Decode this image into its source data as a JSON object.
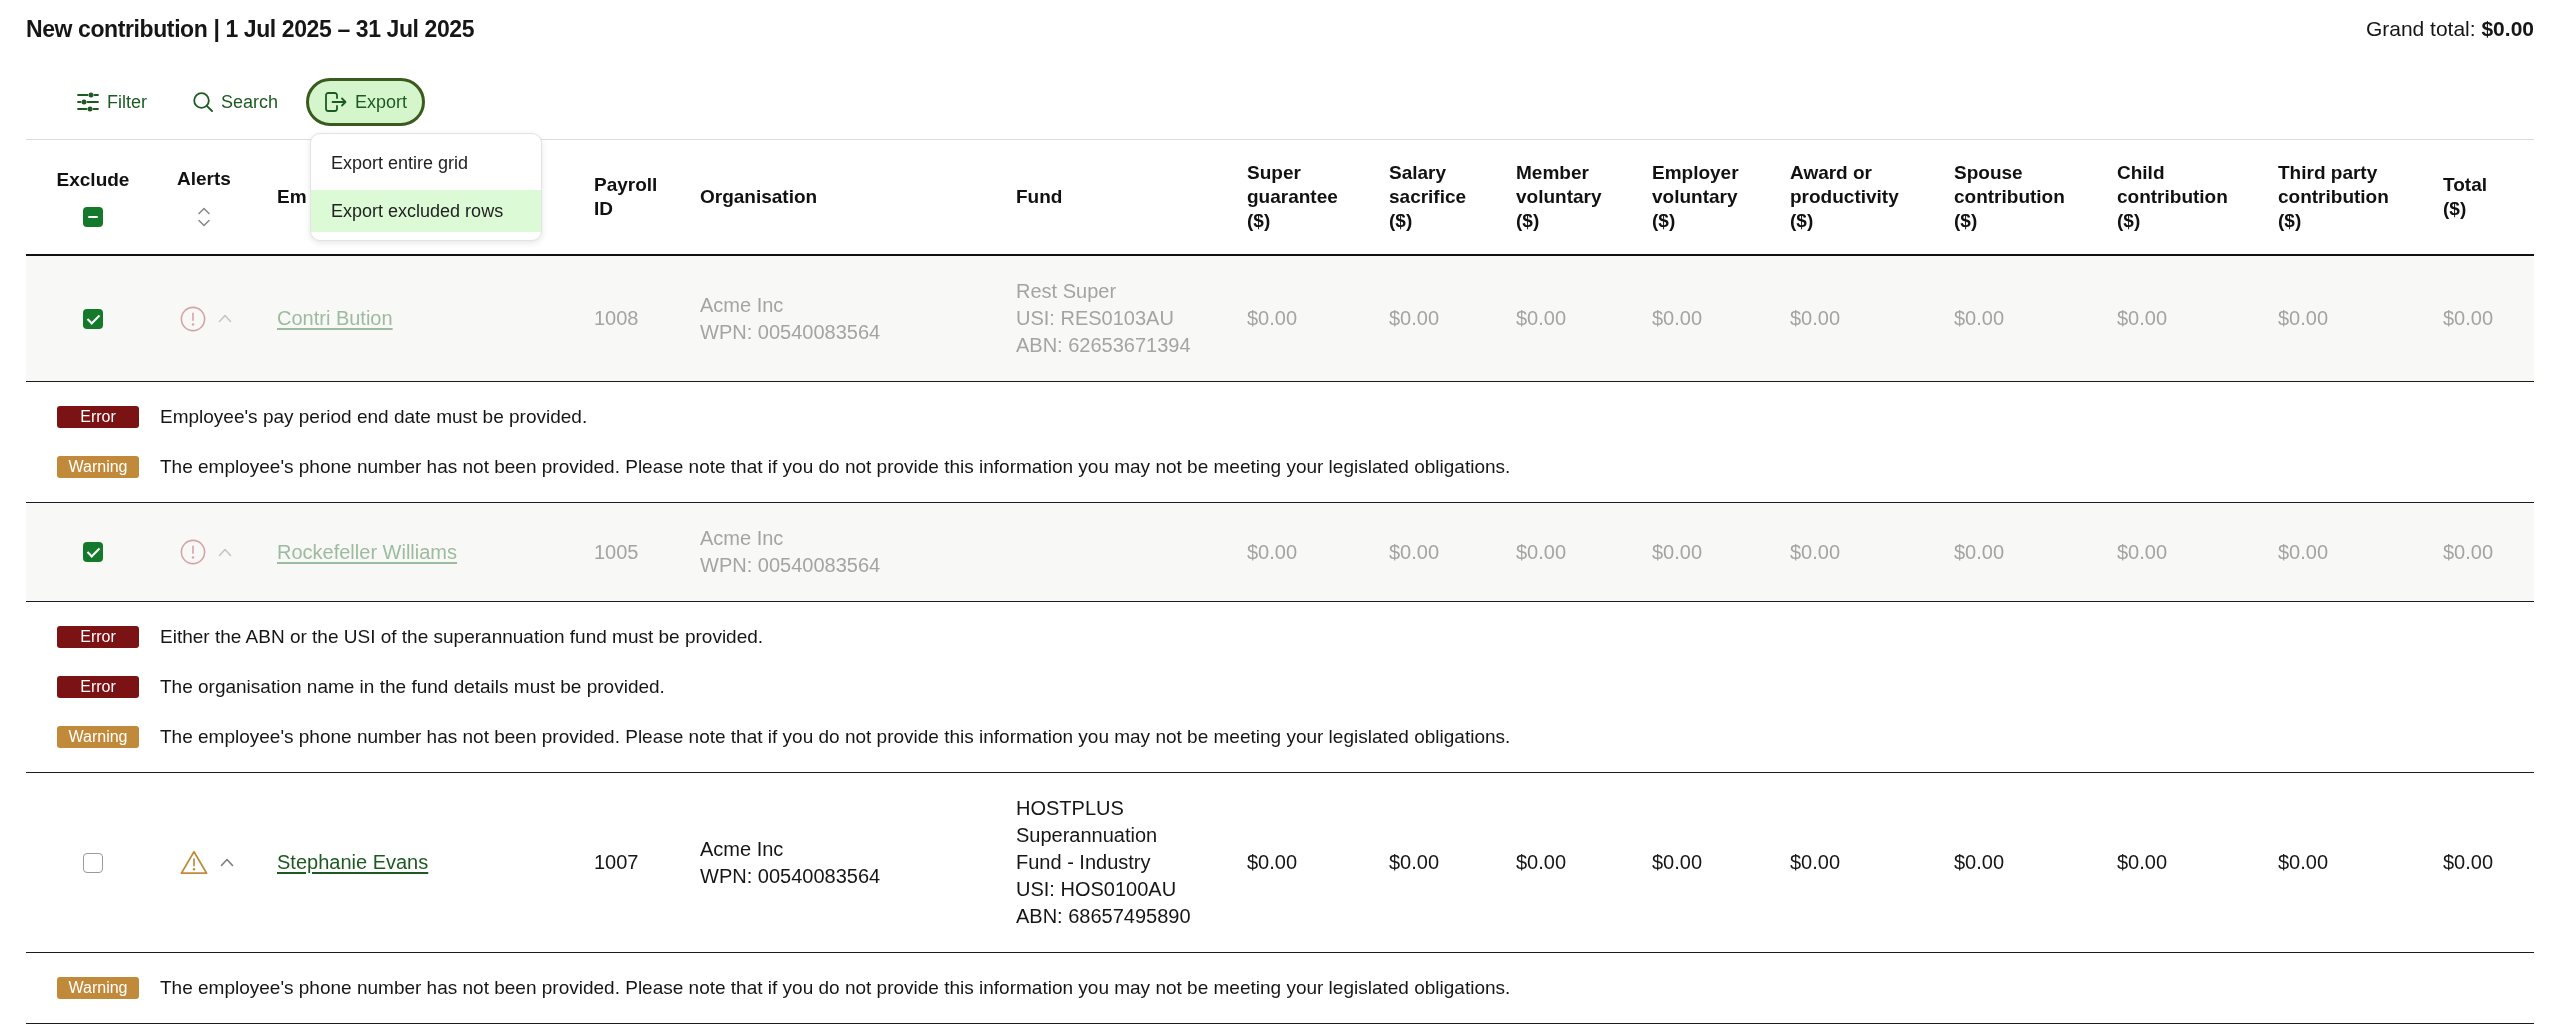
{
  "page": {
    "title": "New contribution | 1 Jul 2025 – 31 Jul 2025",
    "grand_total": "Grand total: **$0.00**"
  },
  "toolbar": [
    {
      "kind": "filter",
      "label": "Filter",
      "expanded": false
    },
    {
      "kind": "search",
      "label": "Search",
      "expanded": false
    },
    {
      "kind": "export",
      "label": "Export",
      "expanded": true,
      "menu": [
        {
          "label": "Export entire grid",
          "selected": false
        },
        {
          "label": "Export excluded rows",
          "selected": true
        }
      ]
    }
  ],
  "table": {
    "columns": [
      {
        "kind": "checkbox",
        "label": "Exclude",
        "indeterminate": true
      },
      {
        "kind": "alerts",
        "label": "Alerts"
      },
      {
        "kind": "employee",
        "label": "Em"
      },
      {
        "kind": "payroll",
        "label": "Payroll ID"
      },
      {
        "kind": "organisation",
        "label": "Organisation"
      },
      {
        "kind": "fund",
        "label": "Fund"
      },
      {
        "kind": "amount",
        "label": "Super guarantee ($)"
      },
      {
        "kind": "amount",
        "label": "Salary sacrifice ($)"
      },
      {
        "kind": "amount",
        "label": "Member voluntary ($)"
      },
      {
        "kind": "amount",
        "label": "Employer voluntary ($)"
      },
      {
        "kind": "amount",
        "label": "Award or productivity ($)"
      },
      {
        "kind": "amount",
        "label": "Spouse contribution ($)"
      },
      {
        "kind": "amount",
        "label": "Child contribution ($)"
      },
      {
        "kind": "amount",
        "label": "Third party contribution ($)"
      },
      {
        "kind": "amount",
        "label": "Total ($)"
      }
    ],
    "rows": [
      {
        "excluded": true,
        "expanded": true,
        "employee": "Contri Bution",
        "payroll_id": "1008",
        "organisation": {
          "name": "Acme Inc",
          "wpn": "WPN: 00540083564"
        },
        "fund": {
          "name": "Rest Super",
          "usi": "USI: RES0103AU",
          "abn": "ABN: 62653671394"
        },
        "amounts": [
          "$0.00",
          "$0.00",
          "$0.00",
          "$0.00",
          "$0.00",
          "$0.00",
          "$0.00",
          "$0.00",
          "$0.00"
        ],
        "alerts": [
          {
            "kind": "error",
            "label": "Error",
            "message": "Employee's pay period end date must be provided."
          },
          {
            "kind": "warning",
            "label": "Warning",
            "message": "The employee's phone number has not been provided. Please note that if you do not provide this information you may not be meeting your legislated obligations."
          }
        ]
      },
      {
        "excluded": true,
        "expanded": true,
        "employee": "Rockefeller Williams",
        "payroll_id": "1005",
        "organisation": {
          "name": "Acme Inc",
          "wpn": "WPN: 00540083564"
        },
        "amounts": [
          "$0.00",
          "$0.00",
          "$0.00",
          "$0.00",
          "$0.00",
          "$0.00",
          "$0.00",
          "$0.00",
          "$0.00"
        ],
        "alerts": [
          {
            "kind": "error",
            "label": "Error",
            "message": "Either the ABN or the USI of the superannuation fund must be provided."
          },
          {
            "kind": "error",
            "label": "Error",
            "message": "The organisation name in the fund details must be provided."
          },
          {
            "kind": "warning",
            "label": "Warning",
            "message": "The employee's phone number has not been provided. Please note that if you do not provide this information you may not be meeting your legislated obligations."
          }
        ]
      },
      {
        "excluded": false,
        "expanded": true,
        "employee": "Stephanie Evans",
        "payroll_id": "1007",
        "organisation": {
          "name": "Acme Inc",
          "wpn": "WPN: 00540083564"
        },
        "fund": {
          "name": "HOSTPLUS Superannuation Fund - Industry",
          "usi": "USI: HOS0100AU",
          "abn": "ABN: 68657495890"
        },
        "amounts": [
          "$0.00",
          "$0.00",
          "$0.00",
          "$0.00",
          "$0.00",
          "$0.00",
          "$0.00",
          "$0.00",
          "$0.00"
        ],
        "alerts": [
          {
            "kind": "warning",
            "label": "Warning",
            "message": "The employee's phone number has not been provided. Please note that if you do not provide this information you may not be meeting your legislated obligations."
          }
        ]
      }
    ]
  }
}
